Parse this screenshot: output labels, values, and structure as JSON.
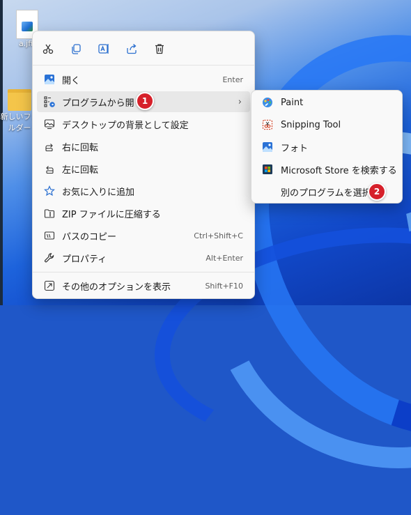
{
  "desktop": {
    "file_label": "a.jfif",
    "folder_label": "新しいフォルダー"
  },
  "toolbar": {
    "icons": [
      "cut-icon",
      "copy-icon",
      "rename-icon",
      "share-icon",
      "delete-icon"
    ]
  },
  "menu": {
    "items": [
      {
        "label": "開く",
        "shortcut": "Enter",
        "icon": "photos-icon"
      },
      {
        "label": "プログラムから開く",
        "shortcut": "",
        "icon": "open-with-icon",
        "submenu": true
      },
      {
        "label": "デスクトップの背景として設定",
        "shortcut": "",
        "icon": "wallpaper-icon"
      },
      {
        "label": "右に回転",
        "shortcut": "",
        "icon": "rotate-right-icon"
      },
      {
        "label": "左に回転",
        "shortcut": "",
        "icon": "rotate-left-icon"
      },
      {
        "label": "お気に入りに追加",
        "shortcut": "",
        "icon": "star-icon"
      },
      {
        "label": "ZIP ファイルに圧縮する",
        "shortcut": "",
        "icon": "zip-icon"
      },
      {
        "label": "パスのコピー",
        "shortcut": "Ctrl+Shift+C",
        "icon": "copy-path-icon"
      },
      {
        "label": "プロパティ",
        "shortcut": "Alt+Enter",
        "icon": "wrench-icon"
      },
      {
        "label": "その他のオプションを表示",
        "shortcut": "Shift+F10",
        "icon": "more-options-icon"
      }
    ]
  },
  "submenu": {
    "items": [
      {
        "label": "Paint",
        "icon": "paint-icon"
      },
      {
        "label": "Snipping Tool",
        "icon": "snipping-tool-icon"
      },
      {
        "label": "フォト",
        "icon": "photos-icon"
      },
      {
        "label": "Microsoft Store を検索する",
        "icon": "store-icon"
      },
      {
        "label": "別のプログラムを選択",
        "icon": ""
      }
    ]
  },
  "badges": {
    "one": "1",
    "two": "2",
    "color": "#d6202a"
  },
  "colors": {
    "menu_bg": "#f9f9f9",
    "highlight": "#e8e8e8",
    "accent": "#0067c0"
  }
}
